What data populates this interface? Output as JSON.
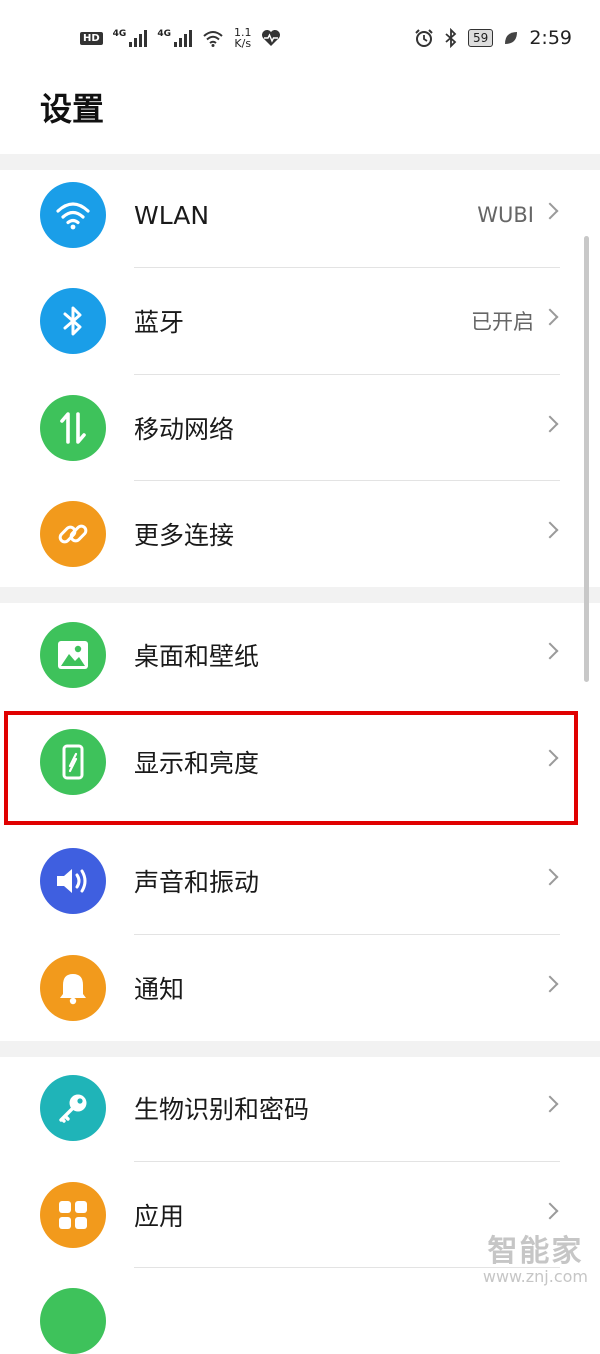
{
  "status_bar": {
    "hd": "HD",
    "net1": "4G",
    "net2": "4G",
    "speed_value": "1.1",
    "speed_unit": "K/s",
    "battery": "59",
    "time": "2:59"
  },
  "page": {
    "title": "设置"
  },
  "settings": {
    "wlan": {
      "label": "WLAN",
      "value": "WUBI",
      "icon": "wifi-icon",
      "color": "#1a9ee8"
    },
    "bluetooth": {
      "label": "蓝牙",
      "value": "已开启",
      "icon": "bluetooth-icon",
      "color": "#1a9ee8"
    },
    "mobile": {
      "label": "移动网络",
      "icon": "mobile-data-icon",
      "color": "#3ec25b"
    },
    "more": {
      "label": "更多连接",
      "icon": "link-icon",
      "color": "#f29a1c"
    },
    "wallpaper": {
      "label": "桌面和壁纸",
      "icon": "image-icon",
      "color": "#3ec25b"
    },
    "display": {
      "label": "显示和亮度",
      "icon": "phone-display-icon",
      "color": "#3ec25b"
    },
    "sound": {
      "label": "声音和振动",
      "icon": "speaker-icon",
      "color": "#3f5fe0"
    },
    "notify": {
      "label": "通知",
      "icon": "bell-icon",
      "color": "#f29a1c"
    },
    "biometrics": {
      "label": "生物识别和密码",
      "icon": "key-icon",
      "color": "#1fb4b8"
    },
    "apps": {
      "label": "应用",
      "icon": "apps-grid-icon",
      "color": "#f29a1c"
    }
  },
  "watermark": {
    "text": "智能家",
    "url": "www.znj.com"
  },
  "accent": {
    "highlight": "#e00000"
  }
}
